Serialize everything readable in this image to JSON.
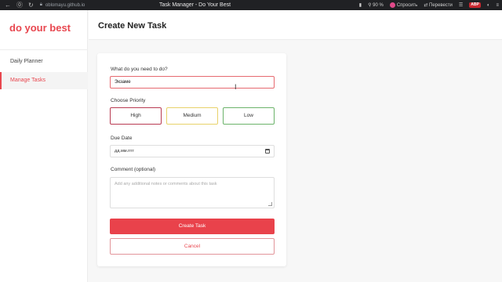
{
  "browser": {
    "url": "oblomayu.github.io",
    "tab_title": "Task Manager - Do Your Best",
    "zoom": "90 %",
    "ask_label": "Спросить",
    "translate_label": "Перевести",
    "abp_label": "ABP"
  },
  "sidebar": {
    "logo": "do your best",
    "items": [
      {
        "label": "Daily Planner"
      },
      {
        "label": "Manage Tasks"
      }
    ]
  },
  "header": {
    "title": "Create New Task"
  },
  "form": {
    "task_label": "What do you need to do?",
    "task_value": "Экзаме",
    "priority_label": "Choose Priority",
    "priorities": [
      "High",
      "Medium",
      "Low"
    ],
    "due_label": "Due Date",
    "due_value": "дд.мм.гггг",
    "comment_label": "Comment (optional)",
    "comment_placeholder": "Add any additional notes or comments about this task",
    "create_label": "Create Task",
    "cancel_label": "Cancel"
  },
  "colors": {
    "accent": "#e9424b",
    "high": "#b93b52",
    "medium": "#e8d26a",
    "low": "#6bb36a"
  }
}
